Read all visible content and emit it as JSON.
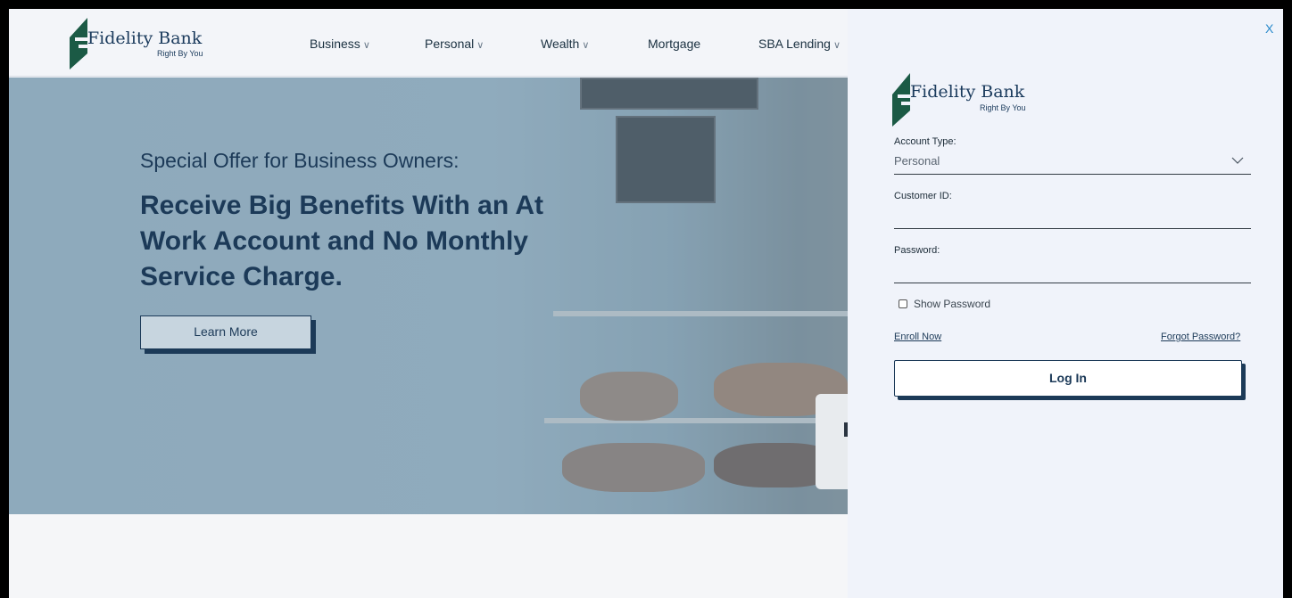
{
  "brand": {
    "name": "Fidelity Bank",
    "tagline": "Right By You"
  },
  "nav": {
    "items": [
      {
        "label": "Business",
        "has_menu": true
      },
      {
        "label": "Personal",
        "has_menu": true
      },
      {
        "label": "Wealth",
        "has_menu": true
      },
      {
        "label": "Mortgage",
        "has_menu": false
      },
      {
        "label": "SBA Lending",
        "has_menu": true
      }
    ]
  },
  "hero": {
    "subtitle": "Special Offer for Business Owners:",
    "title": "Receive Big Benefits With an At Work Account and No Monthly Service Charge.",
    "button_label": "Learn More"
  },
  "login": {
    "close_label": "X",
    "account_type_label": "Account Type:",
    "account_type_value": "Personal",
    "customer_id_label": "Customer ID:",
    "customer_id_value": "",
    "password_label": "Password:",
    "password_value": "",
    "show_password_label": "Show Password",
    "show_password_checked": false,
    "enroll_label": "Enroll Now",
    "forgot_label": "Forgot Password?",
    "login_button_label": "Log In"
  },
  "colors": {
    "brand_navy": "#1c3a58",
    "logo_green": "#1b5a45",
    "panel_bg": "#f0f3fa",
    "close_blue": "#2a8acb"
  },
  "icons": {
    "logo": "fidelity-bank-logo",
    "dropdown": "chevron-down-icon",
    "close": "close-icon"
  }
}
